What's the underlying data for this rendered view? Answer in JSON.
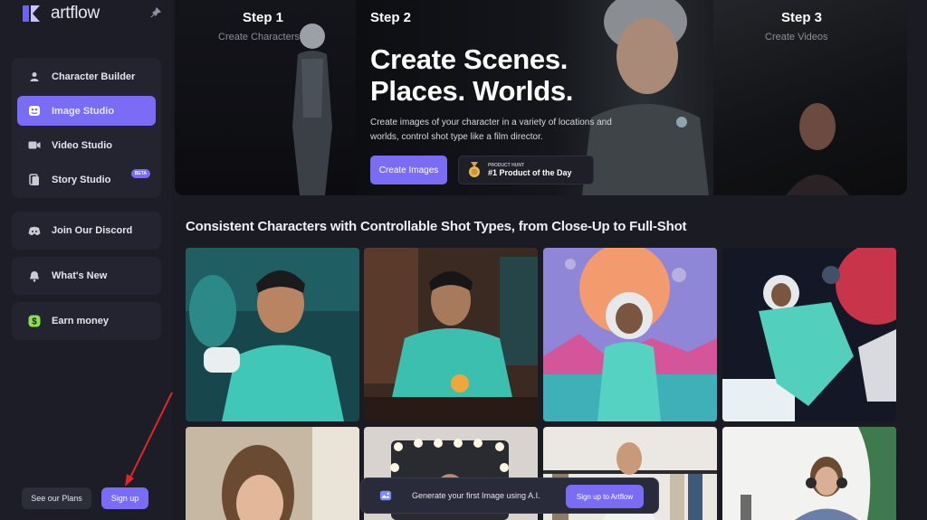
{
  "brand": {
    "name": "artflow"
  },
  "sidebar": {
    "items": [
      {
        "label": "Character Builder",
        "icon": "person-icon",
        "active": false
      },
      {
        "label": "Image Studio",
        "icon": "image-face-icon",
        "active": true
      },
      {
        "label": "Video Studio",
        "icon": "camera-icon",
        "active": false
      },
      {
        "label": "Story Studio",
        "icon": "book-icon",
        "active": false,
        "badge": "BETA"
      }
    ],
    "discord": {
      "label": "Join Our Discord",
      "icon": "discord-icon"
    },
    "whats_new": {
      "label": "What's New",
      "icon": "bell-icon"
    },
    "earn": {
      "label": "Earn money",
      "icon": "dollar-icon"
    },
    "plans_label": "See our Plans",
    "signup_label": "Sign up"
  },
  "hero": {
    "step1": {
      "title": "Step 1",
      "subtitle": "Create Characters"
    },
    "step2": {
      "title": "Step 2"
    },
    "step3": {
      "title": "Step 3",
      "subtitle": "Create Videos"
    },
    "headline_line1": "Create Scenes.",
    "headline_line2": "Places. Worlds.",
    "description": "Create images of your character in a variety of locations and worlds, control shot type like a film director.",
    "cta_label": "Create Images",
    "product_hunt": {
      "small": "PRODUCT HUNT",
      "main": "#1 Product of the Day"
    }
  },
  "section": {
    "title": "Consistent Characters with Controllable Shot Types, from Close-Up to Full-Shot"
  },
  "banner": {
    "text": "Generate your first Image using A.I.",
    "button_label": "Sign up to Artflow"
  },
  "colors": {
    "accent": "#7b6cf6",
    "background": "#1a1b23",
    "panel": "#23242f"
  }
}
